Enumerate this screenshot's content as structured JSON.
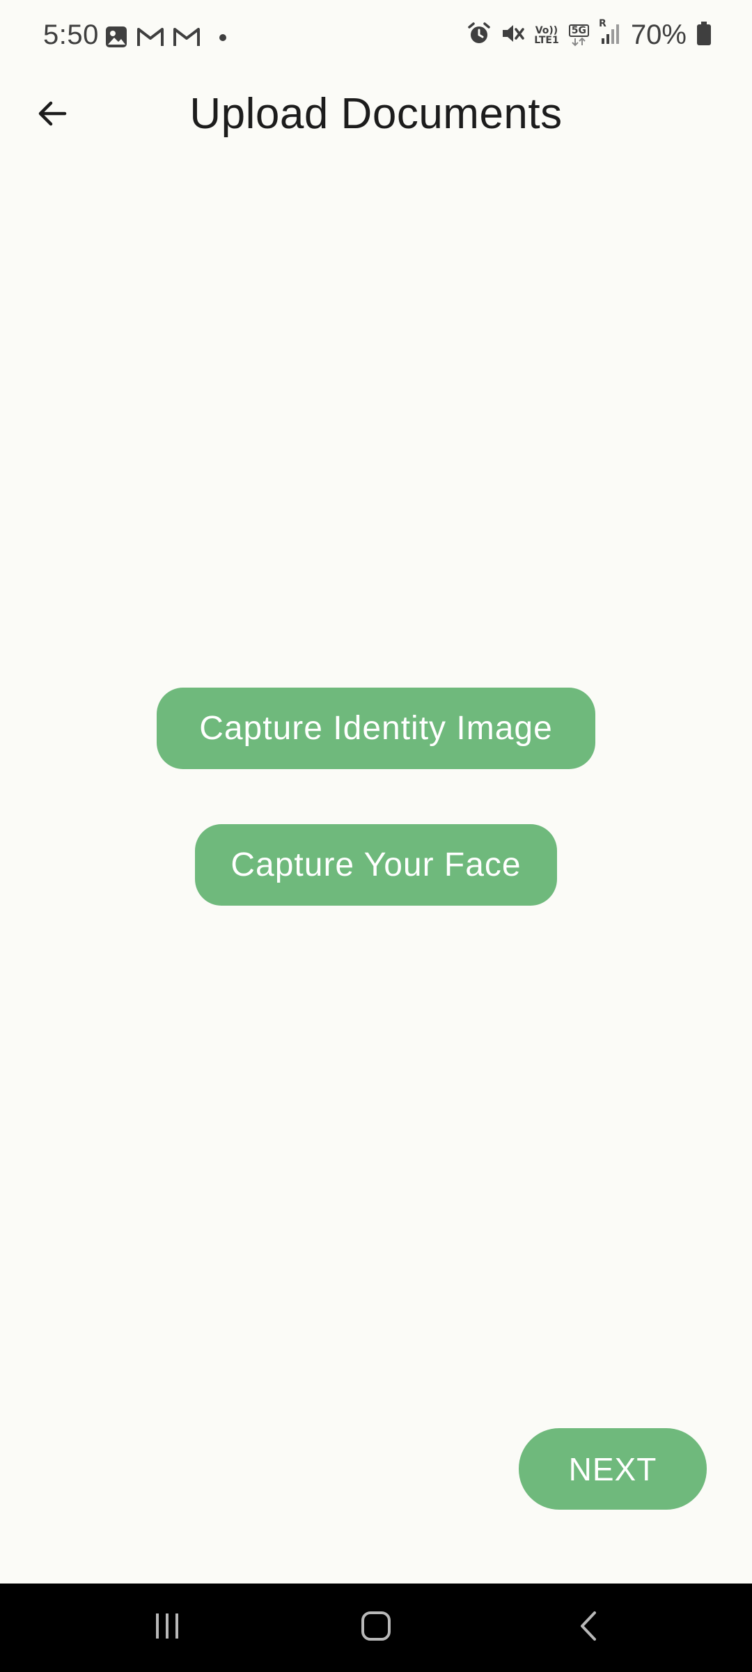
{
  "status_bar": {
    "time": "5:50",
    "left_icons": [
      "gallery-icon",
      "gmail-icon",
      "gmail-icon",
      "dot-icon"
    ],
    "right_icons": [
      "alarm-icon",
      "mute-icon",
      "volte-icon",
      "5g-icon",
      "signal-icon",
      "battery-icon"
    ],
    "volte_label_top": "Vo))",
    "volte_label_bottom": "LTE1",
    "network_label": "5G",
    "roaming_label": "R",
    "battery_percent": "70%"
  },
  "app_bar": {
    "title": "Upload Documents",
    "back_icon": "arrow-left-icon"
  },
  "main": {
    "capture_identity_label": "Capture Identity Image",
    "capture_face_label": "Capture Your Face"
  },
  "footer": {
    "next_label": "NEXT"
  },
  "nav_bar": {
    "items": [
      "recent-apps-icon",
      "home-icon",
      "back-icon"
    ]
  },
  "colors": {
    "background": "#fbfbf7",
    "accent": "#6fb97c",
    "title_text": "#1c1c1c",
    "nav_background": "#000000"
  }
}
